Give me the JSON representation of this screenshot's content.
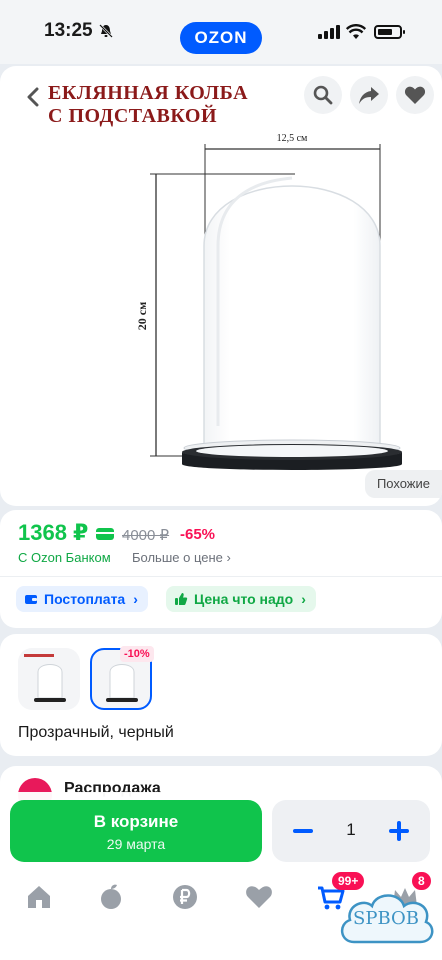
{
  "status_bar": {
    "time": "13:25",
    "brand": "OZON"
  },
  "product_image": {
    "caption_line1": "ЕКЛЯННАЯ КОЛБА",
    "caption_line2": "С ПОДСТАВКОЙ",
    "dimension_width": "12,5 см",
    "dimension_height": "20 см",
    "similar_label": "Похожие"
  },
  "price": {
    "current": "1368 ₽",
    "old": "4000 ₽",
    "discount": "-65%",
    "bank_label": "С Ozon Банком",
    "more_label": "Больше о цене ›",
    "chips": [
      {
        "label": "Постоплата"
      },
      {
        "label": "Цена что надо"
      }
    ]
  },
  "variants": {
    "thumbnail_badge": "-10%",
    "selected_name": "Прозрачный, черный"
  },
  "seller": {
    "name": "Распродажа"
  },
  "cart": {
    "button_label": "В корзине",
    "delivery_date": "29 марта",
    "quantity": "1"
  },
  "tab_bar": {
    "cart_badge": "99+",
    "profile_badge": "8"
  },
  "watermark": "SPBOB",
  "colors": {
    "ozon_blue": "#005bff",
    "price_green": "#10c44c",
    "discount_pink": "#f91155"
  },
  "icons": [
    "back-arrow-icon",
    "search-icon",
    "share-icon",
    "heart-icon",
    "wallet-icon",
    "thumbs-up-icon",
    "home-icon",
    "fresh-icon",
    "ruble-icon",
    "favorites-icon",
    "cart-icon",
    "profile-icon"
  ]
}
